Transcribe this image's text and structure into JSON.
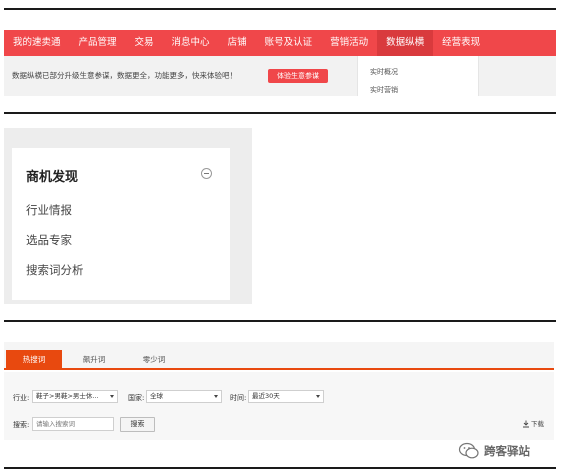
{
  "nav": {
    "items": [
      "我的速卖通",
      "产品管理",
      "交易",
      "消息中心",
      "店铺",
      "账号及认证",
      "营销活动",
      "数据纵横",
      "经营表现"
    ],
    "active_index": 7
  },
  "notice": {
    "text": "数据纵横已部分升级生意参谋，数据更全，功能更多，快来体验吧！",
    "button": "体验生意参谋"
  },
  "dropdown": {
    "items": [
      "实时概况",
      "实时营销"
    ]
  },
  "panel": {
    "title": "商机发现",
    "items": [
      "行业情报",
      "选品专家",
      "搜索词分析"
    ]
  },
  "search": {
    "tabs": [
      "热搜词",
      "飙升词",
      "零少词"
    ],
    "active_tab": 0,
    "industry_label": "行业:",
    "industry_value": "鞋子>男鞋>男士休...",
    "country_label": "国家:",
    "country_value": "全球",
    "time_label": "时间:",
    "time_value": "最近30天",
    "keyword_label": "搜索:",
    "keyword_placeholder": "请输入搜索词",
    "search_button": "搜索",
    "download": "下载"
  },
  "watermark": {
    "text": "跨客驿站"
  },
  "colors": {
    "nav_bg": "#f0474a",
    "tab_accent": "#e8490f"
  }
}
